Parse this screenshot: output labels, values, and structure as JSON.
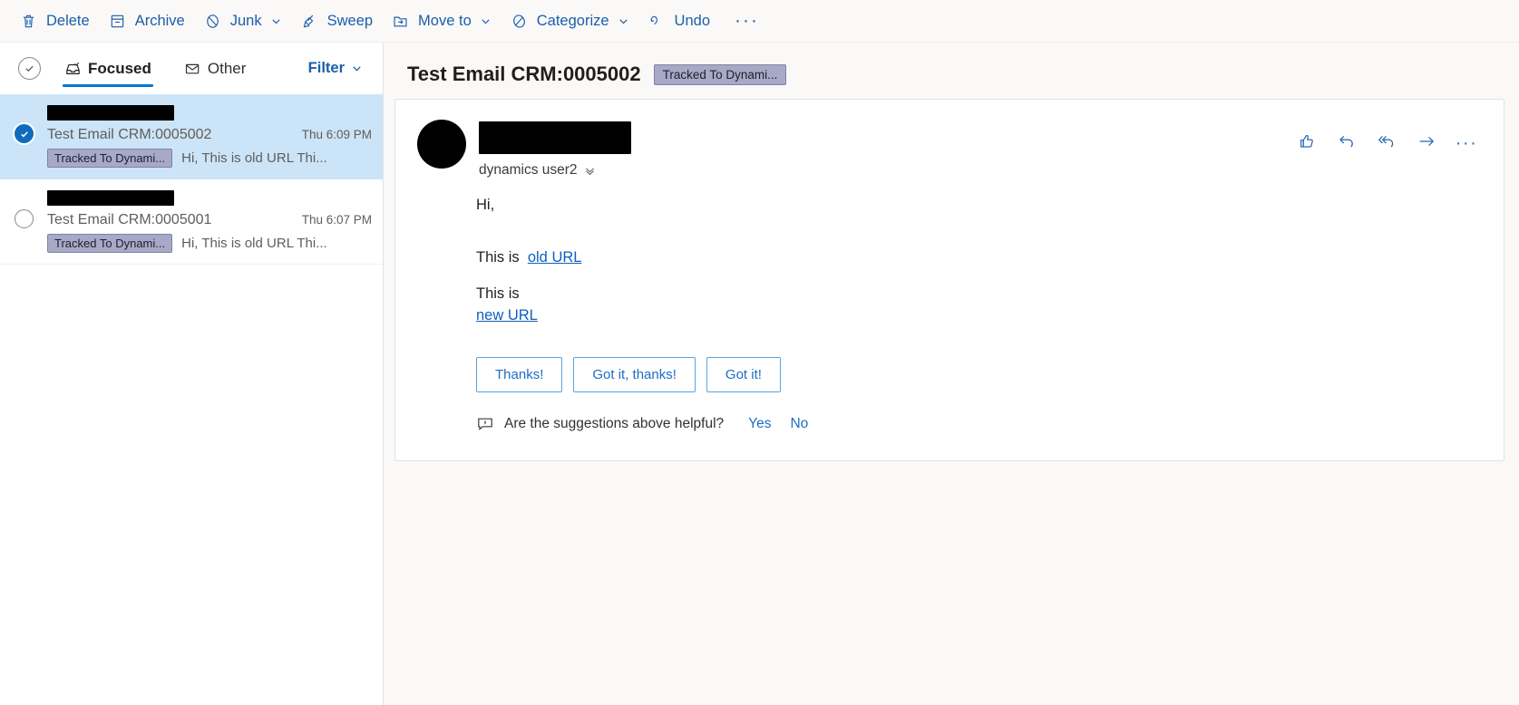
{
  "toolbar": {
    "items": [
      {
        "label": "Delete",
        "icon": "trash-icon",
        "caret": false
      },
      {
        "label": "Archive",
        "icon": "archive-icon",
        "caret": false
      },
      {
        "label": "Junk",
        "icon": "junk-block-icon",
        "caret": true
      },
      {
        "label": "Sweep",
        "icon": "sweep-broom-icon",
        "caret": false
      },
      {
        "label": "Move to",
        "icon": "move-to-folder-icon",
        "caret": true
      },
      {
        "label": "Categorize",
        "icon": "categorize-tag-icon",
        "caret": true
      },
      {
        "label": "Undo",
        "icon": "undo-arrow-icon",
        "caret": false
      }
    ],
    "overflow_label": "···",
    "accent_color": "#1b5eaa"
  },
  "list_header": {
    "select_all_icon": "check-circle-icon",
    "tabs": [
      {
        "label": "Focused",
        "icon": "focused-inbox-icon",
        "active": true
      },
      {
        "label": "Other",
        "icon": "other-mail-icon",
        "active": false
      }
    ],
    "filter_label": "Filter",
    "filter_caret_icon": "chevron-down-icon"
  },
  "messages": [
    {
      "sender_redacted": true,
      "sender_bar_width": 140,
      "subject": "Test Email CRM:0005002",
      "time": "Thu 6:09 PM",
      "badge": "Tracked To Dynami...",
      "preview": "Hi, This is old URL Thi...",
      "selected": true
    },
    {
      "sender_redacted": true,
      "sender_bar_width": 140,
      "subject": "Test Email CRM:0005001",
      "time": "Thu 6:07 PM",
      "badge": "Tracked To Dynami...",
      "preview": "Hi, This is old URL Thi...",
      "selected": false
    }
  ],
  "reading_pane": {
    "subject": "Test Email CRM:0005002",
    "badge": "Tracked To Dynami...",
    "badge_bg": "#a7a9c6",
    "sender": {
      "avatar_icon": "avatar-redacted",
      "name_redacted": true,
      "recipient_line": "dynamics user2",
      "recipient_caret_icon": "chevron-double-down-icon"
    },
    "actions": [
      {
        "name": "like-thumbs-up-icon",
        "label": "Like"
      },
      {
        "name": "reply-icon",
        "label": "Reply"
      },
      {
        "name": "reply-all-icon",
        "label": "Reply all"
      },
      {
        "name": "forward-arrow-icon",
        "label": "Forward"
      },
      {
        "name": "more-actions-icon",
        "label": "···"
      }
    ],
    "body": {
      "greeting": "Hi,",
      "line_old_prefix": "This is",
      "link_old": "old URL",
      "line_new_prefix": "This is",
      "link_new": "new URL"
    },
    "suggested_replies": [
      "Thanks!",
      "Got it, thanks!",
      "Got it!"
    ],
    "feedback": {
      "icon": "feedback-comment-icon",
      "question": "Are the suggestions above helpful?",
      "yes_label": "Yes",
      "no_label": "No"
    }
  }
}
